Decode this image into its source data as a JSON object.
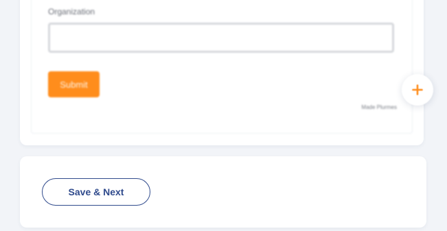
{
  "form_preview": {
    "organization_label": "Organization",
    "organization_value": "",
    "submit_label": "Submit",
    "brand_text": "Made Plurmes"
  },
  "fab": {
    "icon": "plus-icon",
    "color": "#ff8d1c"
  },
  "footer": {
    "save_next_label": "Save & Next"
  },
  "colors": {
    "accent": "#ff8d1c",
    "primary": "#2f4a8c",
    "background": "#f2f4f8"
  }
}
